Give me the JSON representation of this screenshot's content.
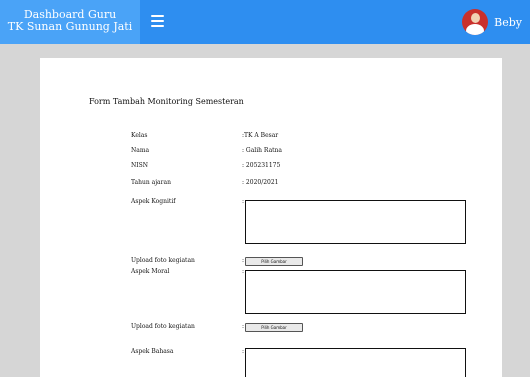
{
  "header": {
    "brand_line1": "Dashboard Guru",
    "brand_line2": "TK Sunan Gunung Jati",
    "menu_icon": "hamburger-menu-icon",
    "user_name": "Beby",
    "colors": {
      "topbar": "#2e8ef0",
      "brand": "#4aa3f7"
    }
  },
  "form": {
    "title": "Form Tambah Monitoring Semesteran",
    "fields": {
      "kelas": {
        "label": "Kelas",
        "value": ":TK A Besar"
      },
      "nama": {
        "label": "Nama",
        "value": ": Galih Ratna"
      },
      "nisn": {
        "label": "NISN",
        "value": ": 205231175"
      },
      "tahun": {
        "label": "Tahun ajaran",
        "value": ": 2020/2021"
      }
    },
    "aspek_kognitif": {
      "label": "Aspek Kognitif",
      "colon": ":",
      "value": ""
    },
    "upload_1": {
      "label": "Upload foto kegiatan",
      "colon": ":",
      "button": "Pilih Gambar"
    },
    "aspek_moral": {
      "label": "Aspek Moral",
      "colon": ":",
      "value": ""
    },
    "upload_2": {
      "label": "Upload foto kegiatan",
      "colon": ":",
      "button": "Pilih Gambar"
    },
    "aspek_bahasa": {
      "label": "Aspek Bahasa",
      "colon": ":",
      "value": ""
    }
  }
}
